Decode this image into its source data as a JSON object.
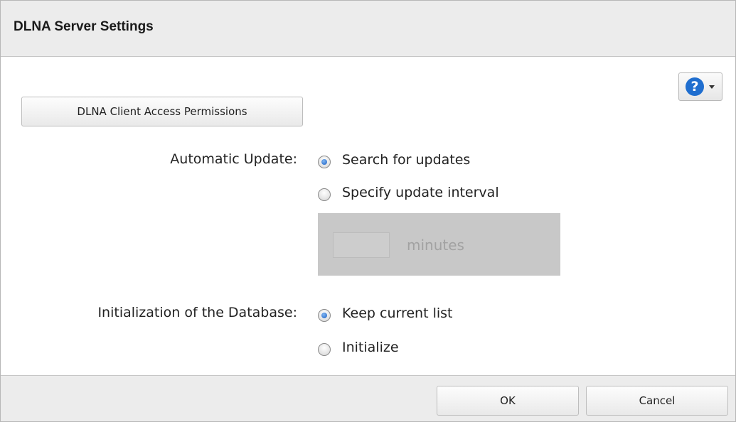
{
  "dialog": {
    "title": "DLNA Server Settings"
  },
  "help": {
    "icon": "question-icon",
    "symbol": "?"
  },
  "access_button": {
    "label": "DLNA Client Access Permissions"
  },
  "automatic_update": {
    "label": "Automatic Update:",
    "options": [
      {
        "label": "Search for updates",
        "selected": true
      },
      {
        "label": "Specify update interval",
        "selected": false
      }
    ],
    "interval": {
      "value": "",
      "unit": "minutes",
      "disabled": true
    }
  },
  "database_init": {
    "label": "Initialization of the Database:",
    "options": [
      {
        "label": "Keep current list",
        "selected": true
      },
      {
        "label": "Initialize",
        "selected": false
      }
    ]
  },
  "footer": {
    "ok_label": "OK",
    "cancel_label": "Cancel"
  },
  "colors": {
    "accent": "#1f6ecf",
    "panel_bg": "#ececec",
    "disabled_bg": "#c8c8c8"
  }
}
